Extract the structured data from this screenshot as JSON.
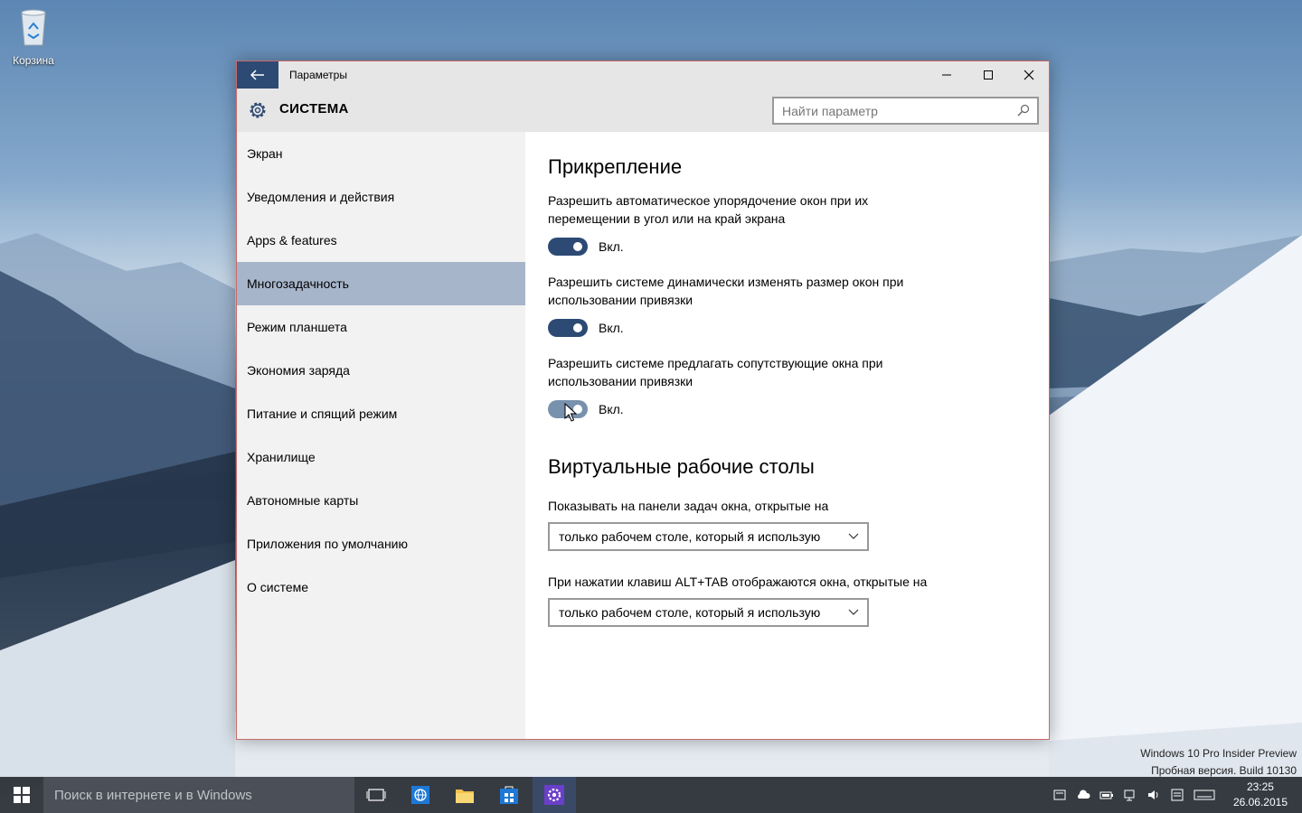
{
  "desktop": {
    "recycle_bin_label": "Корзина"
  },
  "window": {
    "title": "Параметры",
    "section_title": "СИСТЕМА",
    "search_placeholder": "Найти параметр"
  },
  "sidebar": {
    "items": [
      {
        "label": "Экран"
      },
      {
        "label": "Уведомления и действия"
      },
      {
        "label": "Apps & features"
      },
      {
        "label": "Многозадачность",
        "active": true
      },
      {
        "label": "Режим планшета"
      },
      {
        "label": "Экономия заряда"
      },
      {
        "label": "Питание и спящий режим"
      },
      {
        "label": "Хранилище"
      },
      {
        "label": "Автономные карты"
      },
      {
        "label": "Приложения по умолчанию"
      },
      {
        "label": "О системе"
      }
    ]
  },
  "content": {
    "snap_heading": "Прикрепление",
    "snap_settings": [
      {
        "description": "Разрешить автоматическое упорядочение окон при их перемещении в угол или на край экрана",
        "state": "Вкл.",
        "on": true
      },
      {
        "description": "Разрешить системе динамически изменять размер окон при использовании привязки",
        "state": "Вкл.",
        "on": true
      },
      {
        "description": "Разрешить системе предлагать сопутствующие окна при использовании привязки",
        "state": "Вкл.",
        "on": true
      }
    ],
    "vd_heading": "Виртуальные рабочие столы",
    "taskbar_label": "Показывать на панели задач окна, открытые на",
    "taskbar_value": "только рабочем столе, который я использую",
    "alttab_label": "При нажатии клавиш ALT+TAB отображаются окна, открытые на",
    "alttab_value": "только рабочем столе, который я использую"
  },
  "taskbar": {
    "search_placeholder": "Поиск в интернете и в Windows",
    "time": "23:25",
    "date": "26.06.2015"
  },
  "watermark": {
    "line1": "Windows 10 Pro Insider Preview",
    "line2": "Пробная версия. Build 10130"
  },
  "colors": {
    "accent": "#2d4a75",
    "selected_nav": "#a7b5ca"
  }
}
